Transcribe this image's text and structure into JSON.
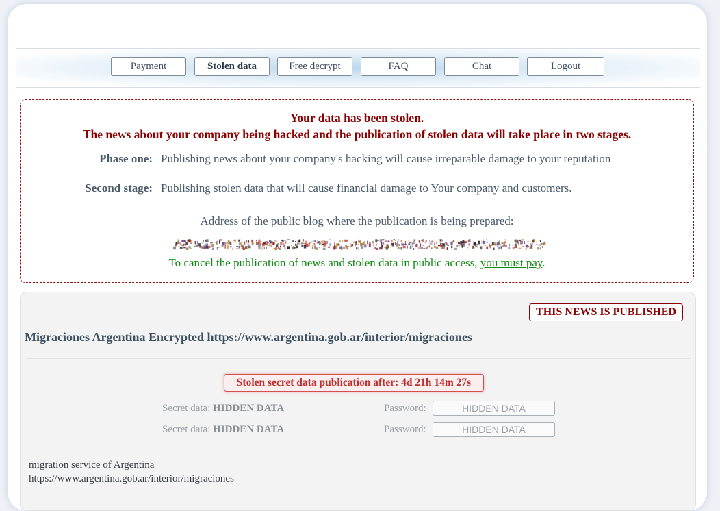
{
  "nav": {
    "items": [
      "Payment",
      "Stolen data",
      "Free decrypt",
      "FAQ",
      "Chat",
      "Logout"
    ],
    "active": "Stolen data"
  },
  "notice": {
    "headline": "Your data has been stolen.",
    "subheadline": "The news about your company being hacked and the publication of stolen data will take place in two stages.",
    "phase_one_label": "Phase one:",
    "phase_one_text": "Publishing news about your company's hacking will cause irreparable damage to your reputation",
    "phase_two_label": "Second stage:",
    "phase_two_text": "Publishing stolen data that will cause financial damage to Your company and customers.",
    "blog_label": "Address of the public blog where the publication is being prepared:",
    "cancel_text": "To cancel the publication of news and stolen data in public access,",
    "cancel_link": "you must pay",
    "cancel_end": "."
  },
  "entry": {
    "status_badge": "THIS NEWS IS PUBLISHED",
    "title": "Migraciones Argentina Encrypted https://www.argentina.gob.ar/interior/migraciones",
    "timer": "Stolen secret data publication after: 4d 21h 14m 27s",
    "secrets": [
      {
        "label": "Secret data:",
        "value": "HIDDEN DATA",
        "password_label": "Password:",
        "password_value": "HIDDEN DATA"
      },
      {
        "label": "Secret data:",
        "value": "HIDDEN DATA",
        "password_label": "Password:",
        "password_value": "HIDDEN DATA"
      }
    ],
    "description_line1": "migration service of Argentina",
    "description_line2": "https://www.argentina.gob.ar/interior/migraciones"
  },
  "colors": {
    "headline": "#8b0000",
    "cancel_green": "#0f8a0f",
    "timer_red": "#c03030",
    "panel_bg": "#ffffff",
    "card_bg": "#f3f3f4"
  }
}
